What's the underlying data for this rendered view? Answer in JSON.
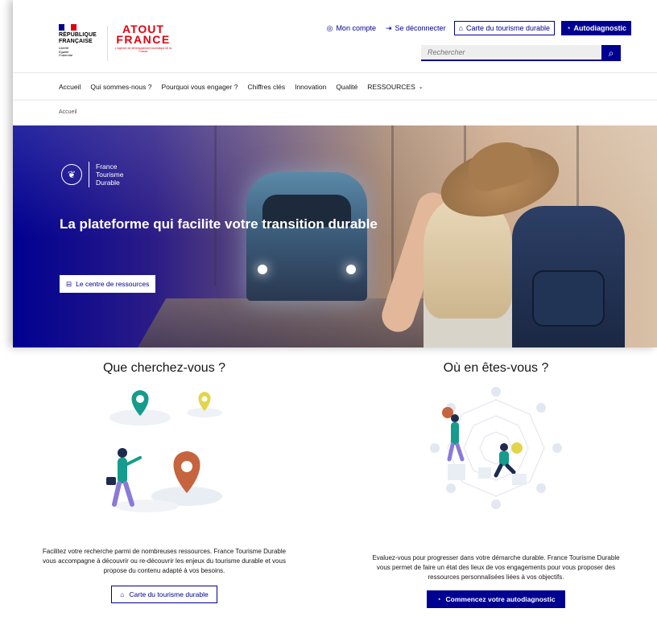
{
  "header": {
    "republic_name": [
      "RÉPUBLIQUE",
      "FRANÇAISE"
    ],
    "republic_motto": [
      "Liberté",
      "Égalité",
      "Fraternité"
    ],
    "brand_line1": "ATOUT",
    "brand_line2": "FRANCE",
    "brand_tagline": "L'Agence de développement touristique de la France",
    "account_label": "Mon compte",
    "logout_label": "Se déconnecter",
    "map_button_label": "Carte du tourisme durable",
    "autodiag_button_label": "Autodiagnostic",
    "search_placeholder": "Rechercher"
  },
  "nav": {
    "items": [
      "Accueil",
      "Qui sommes-nous ?",
      "Pourquoi vous engager ?",
      "Chiffres clés",
      "Innovation",
      "Qualité",
      "RESSOURCES"
    ]
  },
  "breadcrumb": {
    "current": "Accueil"
  },
  "hero": {
    "logo_lines": [
      "France",
      "Tourisme",
      "Durable"
    ],
    "title": "La plateforme qui facilite votre transition durable",
    "button_label": "Le centre de ressources"
  },
  "search_block": {
    "title": "Que cherchez-vous ?",
    "text": "Facilitez votre recherche parmi de nombreuses ressources. France Tourisme Durable vous accompagne à découvrir ou re-découvrir les enjeux du tourisme durable et vous propose du contenu adapté à vos besoins.",
    "button_label": "Carte du tourisme durable"
  },
  "status_block": {
    "title": "Où en êtes-vous ?",
    "text": "Evaluez-vous pour progresser dans votre démarche durable. France Tourisme Durable vous permet de faire un état des lieux de vos engagements pour vous proposer des ressources personnalisées liées à vos objectifs.",
    "button_label": "Commencez votre autodiagnostic"
  },
  "colors": {
    "primary_blue": "#000091",
    "marianne_red": "#e1000f",
    "pin_green": "#169b8c",
    "pin_orange": "#c5643e",
    "pin_yellow": "#e3d449"
  }
}
